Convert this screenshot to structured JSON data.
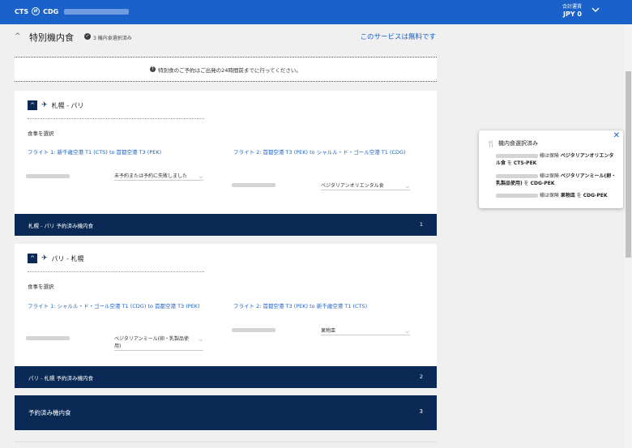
{
  "header": {
    "origin": "CTS",
    "destination": "CDG",
    "total_label": "合計運賃",
    "total_amount": "JPY 0"
  },
  "section": {
    "title": "特別機内食",
    "selected_status": "3 機内食選択済み",
    "free_note": "このサービスは無料です"
  },
  "notice": "特別食のご予約はご出発の24時間前までに行ってください。",
  "legs": [
    {
      "name": "札幌 - パリ",
      "choose_label": "食事を選択",
      "flight1": "フライト 1: 新千歳空港 T1 (CTS) to 首都空港 T3 (PEK)",
      "flight1_meal": "未予約または予約に失敗しました",
      "flight2": "フライト 2: 首都空港 T3 (PEK) to シャルル・ド・ゴール空港 T1 (CDG)",
      "flight2_meal": "ベジタリアンオリエンタル食",
      "summary_label": "札幌 - パリ 予約済み機内食",
      "summary_count": "1"
    },
    {
      "name": "パリ - 札幌",
      "choose_label": "食事を選択",
      "flight1": "フライト 1: シャルル・ド・ゴール空港 T1 (CDG) to 首都空港 T3 (PEK)",
      "flight1_meal": "ベジタリアンミール(卵・乳製品使用)",
      "flight2": "フライト 2: 首都空港 T3 (PEK) to 新千歳空港 T1 (CTS)",
      "flight2_meal": "果物皿",
      "summary_label": "パリ - 札幌 予約済み機内食",
      "summary_count": "2"
    }
  ],
  "booked_total": {
    "label": "予約済み機内食",
    "count": "3"
  },
  "popup": {
    "title": "機内食選択済み",
    "rows": [
      {
        "prefix": "様は保険",
        "meal": "ベジタリアンオリエンタル食",
        "mid": "を",
        "route": "CTS-PEK"
      },
      {
        "prefix": "様は保険",
        "meal": "ベジタリアンミール(卵・乳製品使用)",
        "mid": "を",
        "route": "CDG-PEK"
      },
      {
        "prefix": "様は保険",
        "meal": "果物皿",
        "mid": "を",
        "route": "CDG-PEK"
      }
    ]
  },
  "icons": {
    "colors": {
      "brand_blue": "#1a62c9",
      "navy": "#0a2a55"
    }
  }
}
